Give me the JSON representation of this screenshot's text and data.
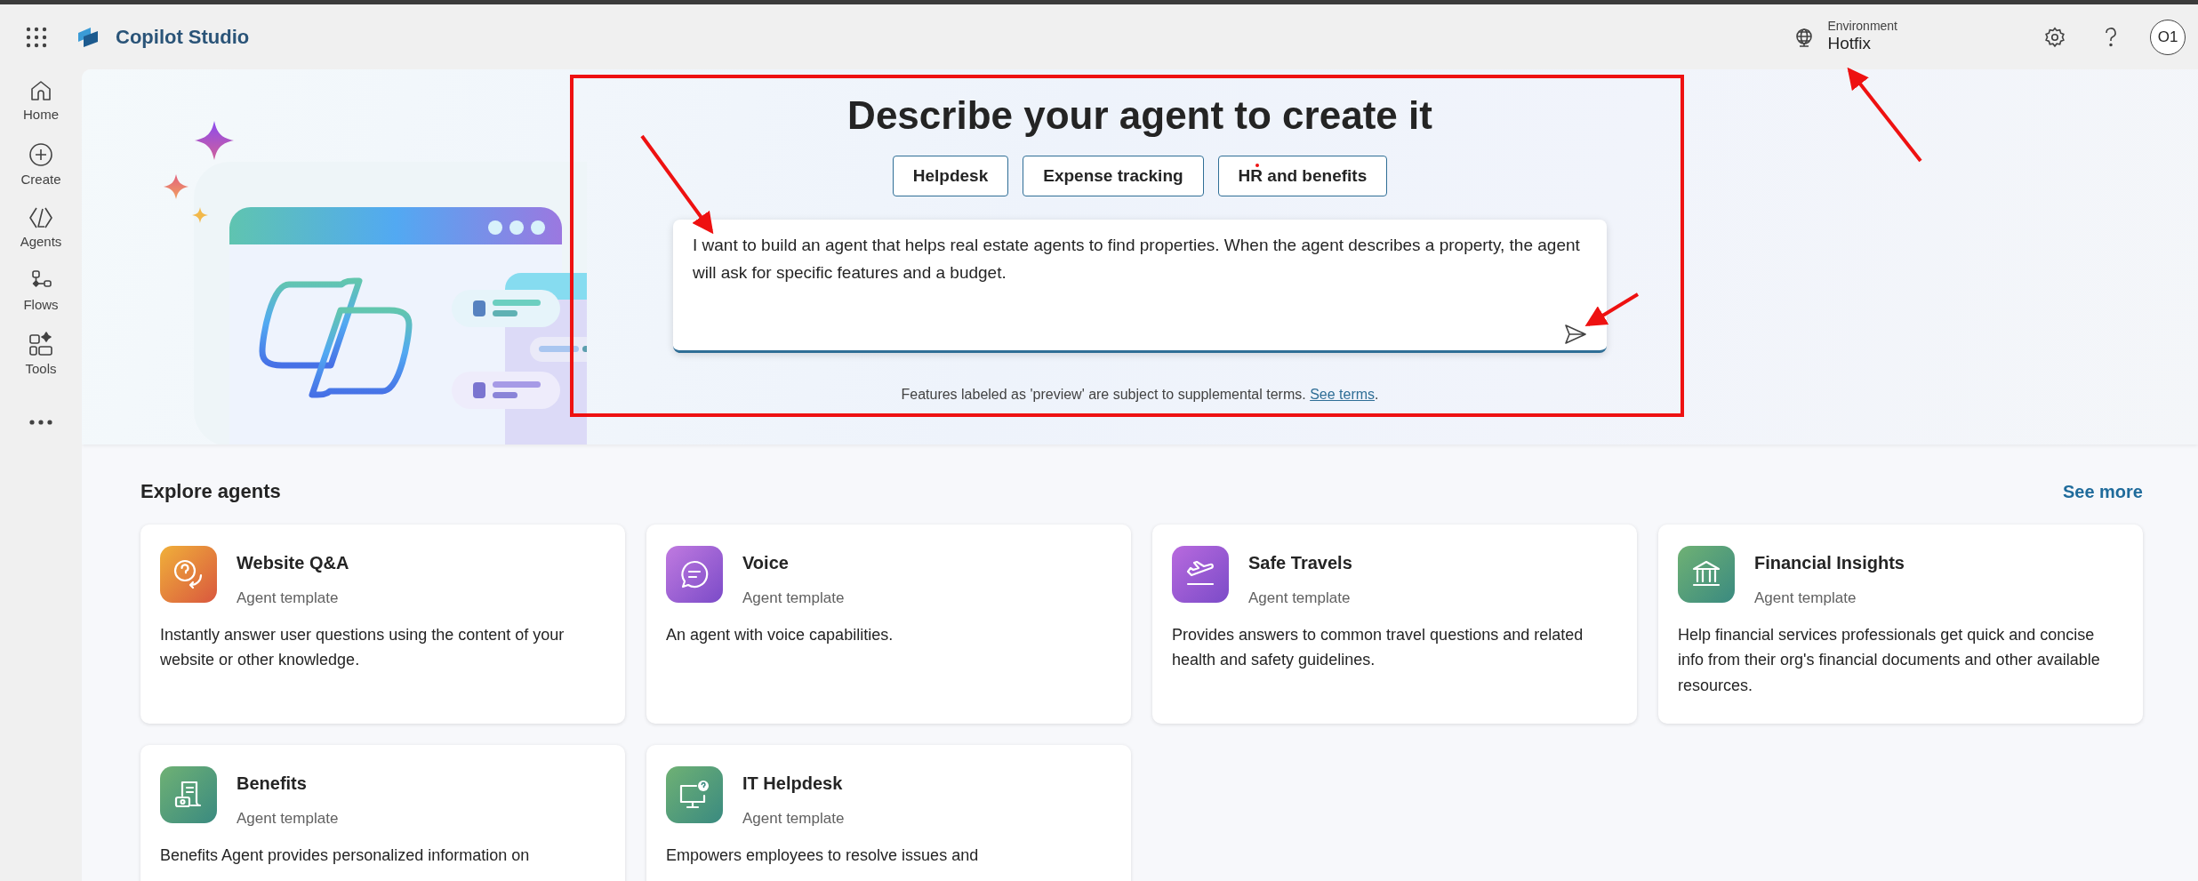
{
  "header": {
    "app_title": "Copilot Studio",
    "environment_label": "Environment",
    "environment_name": "Hotfix",
    "avatar_initials": "O1"
  },
  "sidebar": {
    "items": [
      {
        "label": "Home",
        "kind": "home"
      },
      {
        "label": "Create",
        "kind": "create"
      },
      {
        "label": "Agents",
        "kind": "agents"
      },
      {
        "label": "Flows",
        "kind": "flows"
      },
      {
        "label": "Tools",
        "kind": "tools"
      },
      {
        "kind": "more"
      }
    ]
  },
  "hero": {
    "title": "Describe your agent to create it",
    "suggestions": [
      "Helpdesk",
      "Expense tracking",
      "HR and benefits"
    ],
    "prompt": {
      "value": "I want to build an agent that helps real estate agents to find properties. When the agent describes a property, the agent will ask for specific features and a budget."
    },
    "footnote": {
      "text": "Features labeled as 'preview' are subject to supplemental terms.",
      "link": "See terms",
      "trailing": "."
    }
  },
  "explore": {
    "title": "Explore agents",
    "see_more": "See more",
    "agents": [
      {
        "kind": "qa",
        "name": "Website Q&A",
        "subtitle": "Agent template",
        "description": "Instantly answer user questions using the content of your website or other knowledge."
      },
      {
        "kind": "voice",
        "name": "Voice",
        "subtitle": "Agent template",
        "description": "An agent with voice capabilities."
      },
      {
        "kind": "travel",
        "name": "Safe Travels",
        "subtitle": "Agent template",
        "description": "Provides answers to common travel questions and related health and safety guidelines."
      },
      {
        "kind": "finance",
        "name": "Financial Insights",
        "subtitle": "Agent template",
        "description": "Help financial services professionals get quick and concise info from their org's financial documents and other available resources."
      },
      {
        "kind": "benefits",
        "name": "Benefits",
        "subtitle": "Agent template",
        "description": "Benefits Agent provides personalized information on"
      },
      {
        "kind": "it",
        "name": "IT Helpdesk",
        "subtitle": "Agent template",
        "description": "Empowers employees to resolve issues and"
      }
    ]
  }
}
